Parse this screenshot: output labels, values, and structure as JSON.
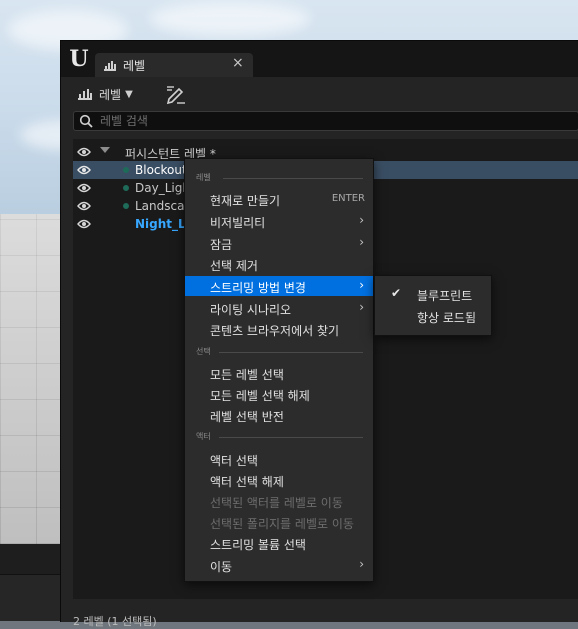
{
  "panel": {
    "tab_label": "레벨",
    "close_glyph": "×"
  },
  "toolbar": {
    "levels_label": "레벨",
    "dropdown_glyph": "▼"
  },
  "search": {
    "placeholder": "레벨 검색"
  },
  "tree": {
    "persistent": "퍼시스턴트 레벨 *",
    "levels": [
      {
        "name": "Blockout",
        "selected": true,
        "current": false
      },
      {
        "name": "Day_Ligh",
        "selected": false,
        "current": false
      },
      {
        "name": "Landscap",
        "selected": false,
        "current": false
      },
      {
        "name": "Night_Lig",
        "selected": false,
        "current": true
      }
    ]
  },
  "status": "2 레벨 (1 선택됨)",
  "menu": {
    "sections": {
      "level": "레벨",
      "selection": "선택",
      "actor": "액터"
    },
    "items": {
      "make_current": "현재로 만들기",
      "make_current_shortcut": "ENTER",
      "visibility": "비저빌리티",
      "lock": "잠금",
      "remove_selected": "선택 제거",
      "change_streaming": "스트리밍 방법 변경",
      "lighting_scenario": "라이팅 시나리오",
      "find_in_cb": "콘텐츠 브라우저에서 찾기",
      "select_all": "모든 레벨 선택",
      "deselect_all": "모든 레벨 선택 해제",
      "invert_selection": "레벨 선택 반전",
      "select_actors": "액터 선택",
      "deselect_actors": "액터 선택 해제",
      "move_actors": "선택된 액터를 레벨로 이동",
      "move_foliage": "선택된 폴리지를 레벨로 이동",
      "select_streaming_volumes": "스트리밍 볼륨 선택",
      "move": "이동"
    },
    "arrow_glyph": "›"
  },
  "submenu": {
    "check_glyph": "✔",
    "blueprint": "블루프린트",
    "always_loaded": "항상 로드됨"
  },
  "colors": {
    "highlight": "#0070e0",
    "selected_row": "#3a4e63",
    "current_level": "#37a7ff"
  }
}
